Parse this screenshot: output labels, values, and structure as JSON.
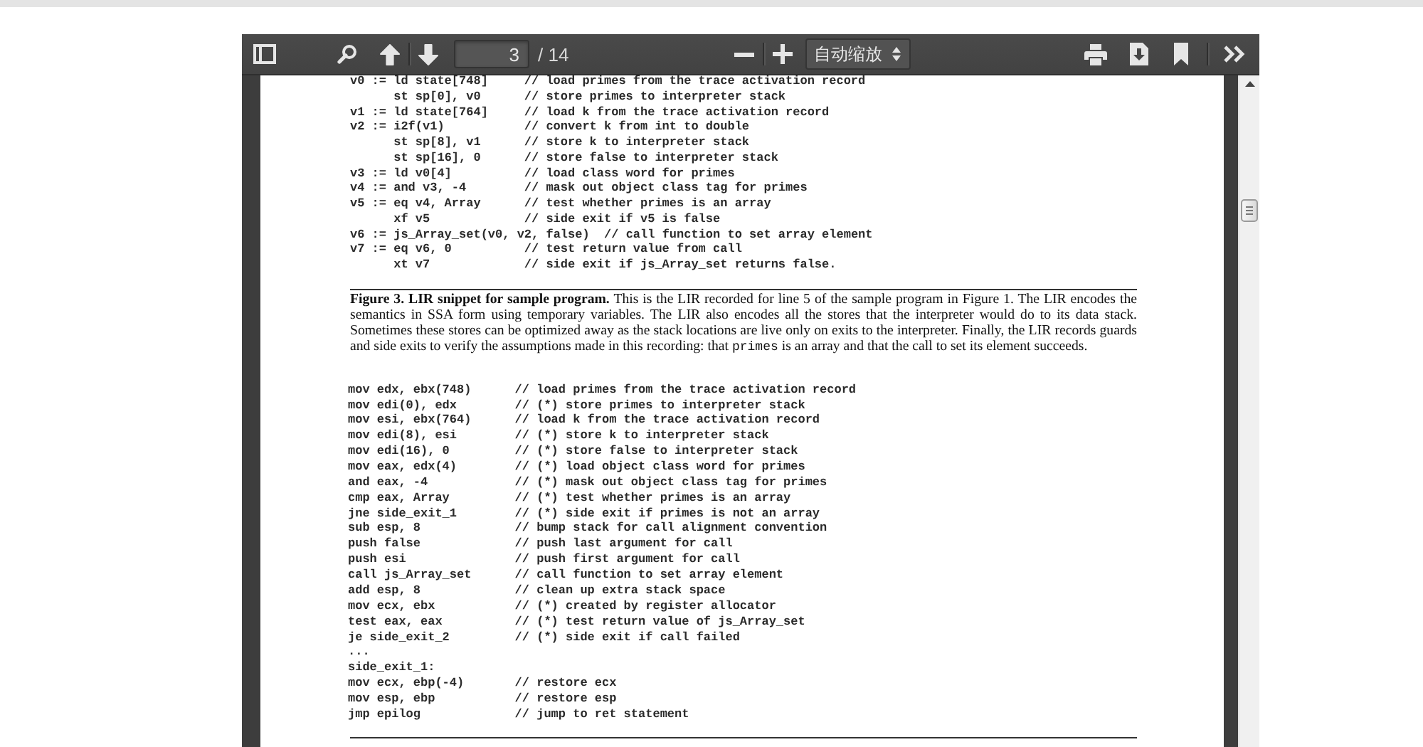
{
  "toolbar": {
    "page_field": {
      "value": "3"
    },
    "page_count": "/ 14",
    "zoom_select": {
      "value": "自动缩放"
    }
  },
  "page": {
    "listing_1": [
      {
        "code": "v0 := ld state[748]",
        "comment": "// load primes from the trace activation record"
      },
      {
        "code": "      st sp[0], v0",
        "comment": "// store primes to interpreter stack"
      },
      {
        "code": "v1 := ld state[764]",
        "comment": "// load k from the trace activation record"
      },
      {
        "code": "v2 := i2f(v1)",
        "comment": "// convert k from int to double"
      },
      {
        "code": "      st sp[8], v1",
        "comment": "// store k to interpreter stack"
      },
      {
        "code": "      st sp[16], 0",
        "comment": "// store false to interpreter stack"
      },
      {
        "code": "v3 := ld v0[4]",
        "comment": "// load class word for primes"
      },
      {
        "code": "v4 := and v3, -4",
        "comment": "// mask out object class tag for primes"
      },
      {
        "code": "v5 := eq v4, Array",
        "comment": "// test whether primes is an array"
      },
      {
        "code": "      xf v5",
        "comment": "// side exit if v5 is false"
      },
      {
        "code": "v6 := js_Array_set(v0, v2, false)",
        "comment": "// call function to set array element"
      },
      {
        "code": "v7 := eq v6, 0",
        "comment": "// test return value from call"
      },
      {
        "code": "      xt v7",
        "comment": "// side exit if js_Array_set returns false."
      }
    ],
    "figure_caption": [
      {
        "kind": "text",
        "text": "**Figure 3. LIR snippet for sample program.** This is the LIR recorded for line 5 of the sample program in Figure 1. The LIR encodes the semantics in SSA form using temporary variables. The LIR also encodes all the stores that the interpreter would do to its data stack. Sometimes these stores can be optimized away as the stack locations are live only on exits to the interpreter. Finally, the LIR records guards and side exits to verify the assumptions made in this recording: that "
      },
      {
        "kind": "code",
        "text": "primes"
      },
      {
        "kind": "text",
        "text": " is an array and that the call to set its element succeeds."
      }
    ],
    "listing_2": [
      {
        "code": "mov edx, ebx(748)",
        "comment": "// load primes from the trace activation record"
      },
      {
        "code": "mov edi(0), edx",
        "comment": "// (*) store primes to interpreter stack"
      },
      {
        "code": "mov esi, ebx(764)",
        "comment": "// load k from the trace activation record"
      },
      {
        "code": "mov edi(8), esi",
        "comment": "// (*) store k to interpreter stack"
      },
      {
        "code": "mov edi(16), 0",
        "comment": "// (*) store false to interpreter stack"
      },
      {
        "code": "mov eax, edx(4)",
        "comment": "// (*) load object class word for primes"
      },
      {
        "code": "and eax, -4",
        "comment": "// (*) mask out object class tag for primes"
      },
      {
        "code": "cmp eax, Array",
        "comment": "// (*) test whether primes is an array"
      },
      {
        "code": "jne side_exit_1",
        "comment": "// (*) side exit if primes is not an array"
      },
      {
        "code": "sub esp, 8",
        "comment": "// bump stack for call alignment convention"
      },
      {
        "code": "push false",
        "comment": "// push last argument for call"
      },
      {
        "code": "push esi",
        "comment": "// push first argument for call"
      },
      {
        "code": "call js_Array_set",
        "comment": "// call function to set array element"
      },
      {
        "code": "add esp, 8",
        "comment": "// clean up extra stack space"
      },
      {
        "code": "mov ecx, ebx",
        "comment": "// (*) created by register allocator"
      },
      {
        "code": "test eax, eax",
        "comment": "// (*) test return value of js_Array_set"
      },
      {
        "code": "je side_exit_2",
        "comment": "// (*) side exit if call failed"
      },
      {
        "code": "..."
      },
      {
        "code": "side_exit_1:"
      },
      {
        "code": "mov ecx, ebp(-4)",
        "comment": "// restore ecx"
      },
      {
        "code": "mov esp, ebp",
        "comment": "// restore esp"
      },
      {
        "code": "jmp epilog",
        "comment": "// jump to ret statement"
      }
    ]
  }
}
